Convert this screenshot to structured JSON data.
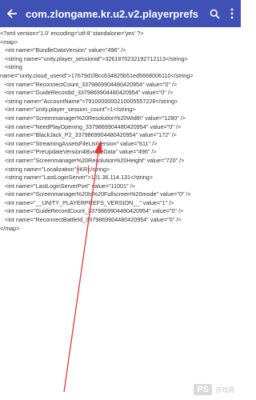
{
  "app_bar": {
    "title": "com.zlongame.kr.u2.v2.playerprefs",
    "background": "#3f51b5"
  },
  "xml": {
    "declaration": "<?xml version='1.0' encoding='utf-8' standalone='yes' ?>",
    "map_open": "<map>",
    "map_close": "</map>",
    "string_open": "<string",
    "line1": "<int name=\"BundleDataVersion\" value=\"496\" />",
    "line2": "<string name=\"unity.player_sessionid\">3261870232192712113</string>",
    "line3": "name=\"unity.cloud_userid\">17679d1f8cc634825b51ed5668006110</string>",
    "line4": "<int name=\"ReconnectCount_3379869904480420954\" value=\"0\" />",
    "line5": "<int name=\"GuideRecordId_3379869904480420954\" value=\"0\" />",
    "line6": "<string name=\"AccountName\">7910000000210005557228</string>",
    "line7": "<int name=\"unity.player_session_count\">1</string>",
    "line8": "<int name=\"Screenmanager%20Resolution%20Width\" value=\"1280\" />",
    "line9": "<int name=\"NeedPlayOpening_3379869904480420954\" value=\"0\" />",
    "line10": "<int name=\"BlackJack_P2_3379869904480420954\" value=\"172\" />",
    "line11": "<int name=\"StreamingAssetsFileListVersion\" value=\"611\" />",
    "line12": "<int name=\"PreUpdateVersion4BundleData\" value=\"496\" />",
    "line13": "<int name=\"Screenmanager%20Resolution%20Height\" value=\"720\" />",
    "line14_prefix": "<string name=\"Localization\">",
    "line14_value": "KR",
    "line14_suffix": "</string>",
    "line15": "<string name=\"LastLoginServer\">101.36.114.131</string>",
    "line16": "<int name=\"LastLoginServerPort\" value=\"11001\" />",
    "line17": "<int name=\"Screenmanager%20Is%20Fullscreen%20mode\" value=\"0\" />",
    "line18": "<int name=\"__UNITY_PLAYERPREFS_VERSION__\" value=\"1\" />",
    "line19": "<int name=\"GuideRecordCount_3379869904480420954\" value=\"0\" />",
    "line20": "<int name=\"ReconnectBattleId_3379869904480420954\" value=\"0\" />"
  },
  "icons": {
    "back": "arrow-left-icon",
    "search": "search-icon",
    "more": "more-vert-icon"
  },
  "annotation": {
    "color": "#e53935"
  },
  "watermark": {
    "logo": "PS",
    "text": "游戏网"
  }
}
